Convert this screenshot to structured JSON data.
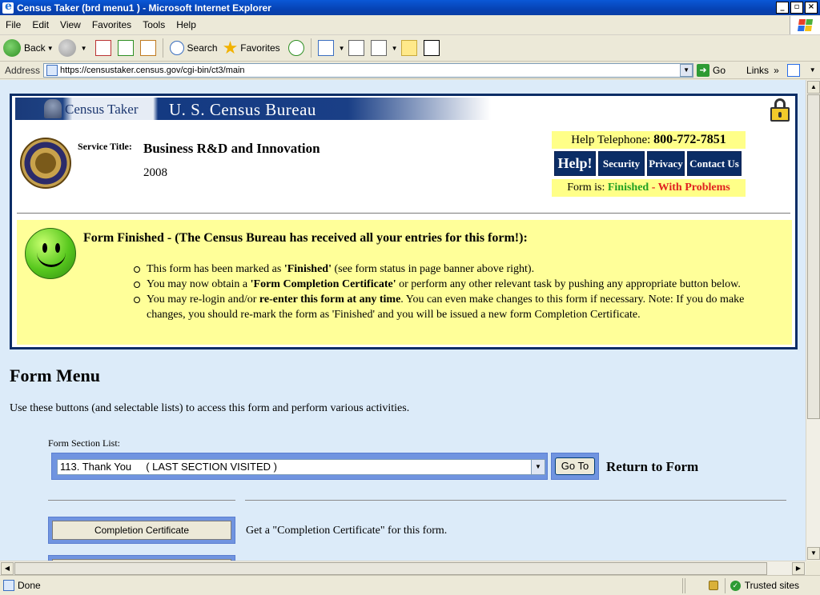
{
  "window": {
    "title": "Census Taker (brd menu1 ) - Microsoft Internet Explorer",
    "controls": {
      "minimize": "_",
      "maximize": "▫",
      "close": "×"
    }
  },
  "menu": [
    "File",
    "Edit",
    "View",
    "Favorites",
    "Tools",
    "Help"
  ],
  "toolbar": {
    "back": "Back",
    "search": "Search",
    "favorites": "Favorites"
  },
  "address": {
    "label": "Address",
    "url": "https://censustaker.census.gov/cgi-bin/ct3/main",
    "go": "Go",
    "links": "Links",
    "links_more": "»"
  },
  "banner": {
    "app_name": "Census Taker",
    "agency": "U. S. Census Bureau",
    "service_title_label": "Service Title:",
    "service_title": "Business R&D and Innovation",
    "year": "2008",
    "help_telephone_label": "Help Telephone:",
    "help_telephone": "800-772-7851",
    "nav": [
      "Help!",
      "Security",
      "Privacy",
      "Contact Us"
    ],
    "form_is_label": "Form is:",
    "form_status_finished": "Finished",
    "form_status_separator": " - ",
    "form_status_problems": "With Problems",
    "colors": {
      "navy": "#0b2d66",
      "status_green": "#22a022",
      "status_red": "#e02020",
      "highlight": "#ffff88"
    }
  },
  "finished_notice": {
    "title": "Form Finished - (The Census Bureau has received all your entries for this form!):",
    "items": [
      {
        "pre": "This form has been marked as ",
        "bold": "'Finished'",
        "post": " (see form status in page banner above right)."
      },
      {
        "pre": "You may now obtain a ",
        "bold": "'Form Completion Certificate'",
        "post": " or perform any other relevant task by pushing any appropriate button below."
      },
      {
        "pre": "You may re-login and/or ",
        "bold": "re-enter this form at any time",
        "post": ". You can even make changes to this form if necessary. Note: If you do make changes, you should re-mark the form as 'Finished' and you will be issued a new form Completion Certificate."
      }
    ]
  },
  "form_menu": {
    "title": "Form Menu",
    "description": "Use these buttons (and selectable lists) to access this form and perform various activities.",
    "section_list_label": "Form Section List:",
    "selected_section": "113. Thank You     ( LAST SECTION VISITED )",
    "go_to": "Go To",
    "return_to_form": "Return to Form",
    "completion_certificate": "Completion Certificate",
    "completion_certificate_desc": "Get a \"Completion Certificate\" for this form."
  },
  "status": {
    "text": "Done",
    "zone": "Trusted sites"
  }
}
